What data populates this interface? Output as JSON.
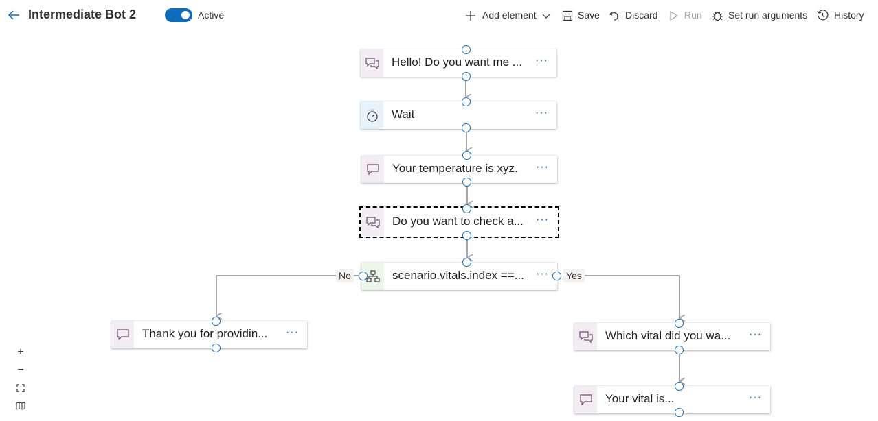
{
  "header": {
    "title": "Intermediate Bot 2",
    "toggle_label": "Active",
    "toolbar": {
      "add_element": "Add element",
      "save": "Save",
      "discard": "Discard",
      "run": "Run",
      "set_run_arguments": "Set run arguments",
      "history": "History"
    }
  },
  "nodes": {
    "n1": "Hello! Do you want me ...",
    "n2": "Wait",
    "n3": "Your temperature is xyz.",
    "n4": "Do you want to check a...",
    "n5": "scenario.vitals.index ==...",
    "n6": "Thank you for providin...",
    "n7": "Which vital did you wa...",
    "n8": "Your vital is..."
  },
  "branches": {
    "no": "No",
    "yes": "Yes"
  },
  "more_label": "···",
  "zoom": {
    "in": "+",
    "out": "−"
  },
  "colors": {
    "accent": "#0f6cbd",
    "edge": "#a6a6a6"
  }
}
